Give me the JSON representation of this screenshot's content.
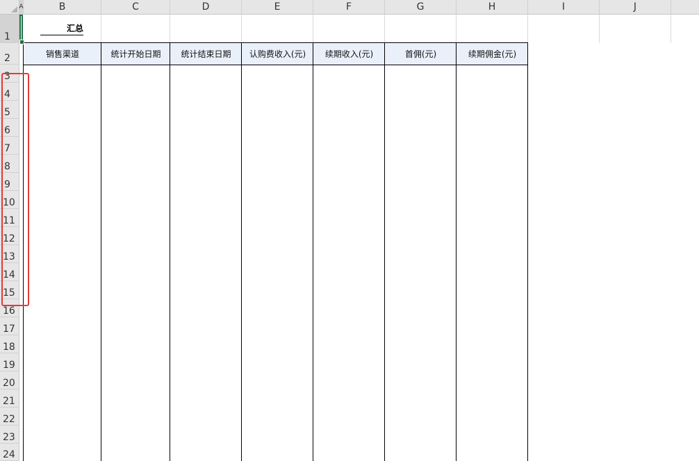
{
  "columns": [
    "A",
    "B",
    "C",
    "D",
    "E",
    "F",
    "G",
    "H",
    "I",
    "J"
  ],
  "rows": [
    "1",
    "2",
    "3",
    "4",
    "5",
    "6",
    "7",
    "8",
    "9",
    "10",
    "11",
    "12",
    "13",
    "14",
    "15",
    "16",
    "17",
    "18",
    "19",
    "20",
    "21",
    "22",
    "23",
    "24"
  ],
  "title": "汇总",
  "headers": [
    "销售渠道",
    "统计开始日期",
    "统计结束日期",
    "认购费收入(元)",
    "续期收入(元)",
    "首佣(元)",
    "续期佣金(元)"
  ],
  "colors": {
    "highlight": "#e53935",
    "header_fill": "#e9f0fa",
    "active_cell": "#1e7145"
  }
}
